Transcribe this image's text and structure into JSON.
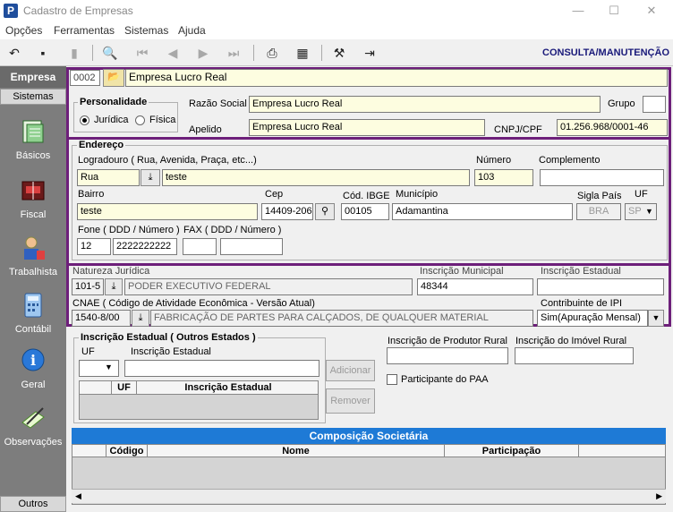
{
  "window": {
    "title": "Cadastro de Empresas",
    "minimize": "—",
    "maximize": "☐",
    "close": "✕"
  },
  "menu": [
    "Opções",
    "Ferramentas",
    "Sistemas",
    "Ajuda"
  ],
  "toolbar": {
    "mode": "CONSULTA/MANUTENÇÃO"
  },
  "nav": {
    "header": "Empresa",
    "sistemas": "Sistemas",
    "outros": "Outros",
    "items": [
      "Básicos",
      "Fiscal",
      "Trabalhista",
      "Contábil",
      "Geral",
      "Observações"
    ]
  },
  "empresa": {
    "codigo": "0002",
    "nome": "Empresa Lucro Real"
  },
  "personalidade": {
    "title": "Personalidade",
    "juridica": "Jurídica",
    "fisica": "Física",
    "selected": "juridica"
  },
  "ident": {
    "razao_label": "Razão Social",
    "razao": "Empresa Lucro Real",
    "grupo_label": "Grupo",
    "grupo": "",
    "apelido_label": "Apelido",
    "apelido": "Empresa Lucro Real",
    "cnpj_label": "CNPJ/CPF",
    "cnpj": "01.256.968/0001-46"
  },
  "endereco": {
    "title": "Endereço",
    "logradouro_label": "Logradouro ( Rua, Avenida, Praça, etc...)",
    "tipo": "Rua",
    "logradouro": "teste",
    "numero_label": "Número",
    "numero": "103",
    "complemento_label": "Complemento",
    "complemento": "",
    "bairro_label": "Bairro",
    "bairro": "teste",
    "cep_label": "Cep",
    "cep": "14409-206",
    "ibge_label": "Cód. IBGE",
    "ibge": "00105",
    "municipio_label": "Município",
    "municipio": "Adamantina",
    "sigla_label": "Sigla País",
    "sigla": "BRA",
    "uf_label": "UF",
    "uf": "SP",
    "fone_label": "Fone ( DDD / Número )",
    "fone_ddd": "12",
    "fone_num": "2222222222",
    "fax_label": "FAX ( DDD / Número )",
    "fax_ddd": "",
    "fax_num": ""
  },
  "fiscal": {
    "natureza_label": "Natureza Jurídica",
    "natureza_cod": "101-5",
    "natureza_desc": "PODER EXECUTIVO FEDERAL",
    "insc_mun_label": "Inscrição Municipal",
    "insc_mun": "48344",
    "insc_est_label": "Inscrição Estadual",
    "insc_est": "",
    "cnae_label": "CNAE ( Código de Atividade Econômica - Versão Atual)",
    "cnae_cod": "1540-8/00",
    "cnae_desc": "FABRICAÇÃO DE PARTES PARA CALÇADOS, DE QUALQUER MATERIAL",
    "ipi_label": "Contribuinte de IPI",
    "ipi": "Sim(Apuração Mensal)"
  },
  "outros_estados": {
    "title": "Inscrição Estadual ( Outros Estados )",
    "uf_label": "UF",
    "ie_label": "Inscrição Estadual",
    "adicionar": "Adicionar",
    "remover": "Remover",
    "col_uf": "UF",
    "col_ie": "Inscrição Estadual"
  },
  "rural": {
    "produtor_label": "Inscrição de Produtor Rural",
    "imovel_label": "Inscrição do Imóvel Rural",
    "paa_label": "Participante do PAA"
  },
  "societaria": {
    "title": "Composição Societária",
    "col_codigo": "Código",
    "col_nome": "Nome",
    "col_participacao": "Participação"
  },
  "colors": {
    "accent_border": "#6d1f7a",
    "header_blue": "#1e7ad6",
    "nav_gray": "#7d7d7d"
  }
}
